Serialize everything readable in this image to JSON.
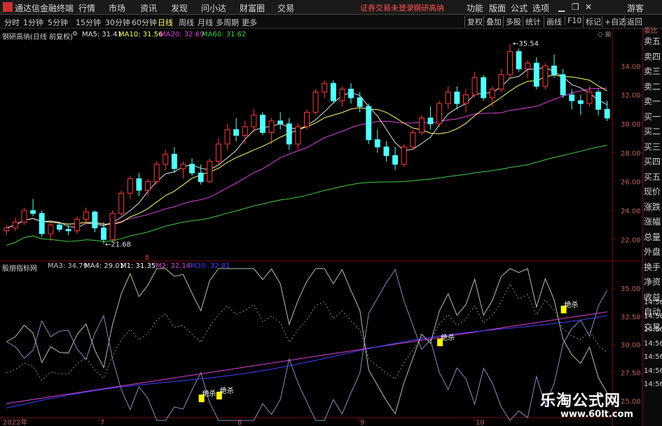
{
  "menubar": {
    "app_name": "通达信金融终端",
    "items": [
      "行情",
      "市场",
      "资讯",
      "发现",
      "问小达",
      "财富圈",
      "交易"
    ],
    "center_status": "证券交易未登录",
    "center_stock": "钢研高纳",
    "right_items": [
      "功能",
      "版面",
      "公式",
      "选项"
    ],
    "guest": "游客",
    "window_buttons": [
      "▁",
      "❐",
      "✕"
    ]
  },
  "toolbar": {
    "periods": [
      "分时",
      "1分钟",
      "5分钟",
      "15分钟",
      "30分钟",
      "60分钟",
      "日线",
      "周线",
      "月线",
      "多周期",
      "更多"
    ],
    "selected": "日线",
    "right_buttons": [
      "复权",
      "叠加",
      "多股",
      "统计",
      "画线",
      "F10",
      "标记",
      "+自选",
      "返回"
    ]
  },
  "main_chart": {
    "title": "钢研高纳(日线 前复权)",
    "ma_labels": [
      {
        "text": "MA5: 31.41",
        "color": "#e0e0e0"
      },
      {
        "text": "MA10: 31.56",
        "color": "#ffff66"
      },
      {
        "text": "MA20: 32.69",
        "color": "#e040e0"
      },
      {
        "text": "MA60: 31.62",
        "color": "#40d040"
      }
    ],
    "high_label": "35.54",
    "low_label": "21.68",
    "marker_8": "8"
  },
  "indicator": {
    "title": "股朋指标网",
    "labels": [
      {
        "text": "MA3: 34.79",
        "color": "#c0c0c0"
      },
      {
        "text": "MA4: 29.01",
        "color": "#e0e0e0"
      },
      {
        "text": "M1: 31.35",
        "color": "#ffffff"
      },
      {
        "text": "M2: 32.14",
        "color": "#e040e0"
      },
      {
        "text": "M30: 32.81",
        "color": "#4040ff"
      }
    ],
    "signal_label": "绝杀"
  },
  "right_panel": {
    "top_label": "委比",
    "items": [
      "卖五",
      "卖四",
      "卖三",
      "卖二",
      "卖一",
      "买一",
      "买二",
      "买三",
      "买四",
      "买五",
      "现价",
      "涨跌",
      "涨幅",
      "总量",
      "外盘",
      "换手",
      "净资",
      "收益",
      "自动",
      "交易"
    ],
    "time_items": [
      "14:56",
      "14:56",
      "14:56",
      "14:56",
      "14:56",
      "14:56",
      "14:56"
    ]
  },
  "watermark": {
    "text": "乐淘公式网",
    "url": "www.60lt.com"
  },
  "chart_data": [
    {
      "type": "candlestick",
      "ylim": [
        21,
        36
      ],
      "yticks": [
        22,
        24,
        26,
        28,
        30,
        32,
        34
      ],
      "x_labels": [
        "2022年",
        "7",
        "8",
        "9",
        "10"
      ],
      "ohlc": [
        [
          22.6,
          23.0,
          22.3,
          22.8
        ],
        [
          22.8,
          23.5,
          22.6,
          23.2
        ],
        [
          23.2,
          24.2,
          23.0,
          24.0
        ],
        [
          24.0,
          24.8,
          23.6,
          23.8
        ],
        [
          23.8,
          24.0,
          22.2,
          22.4
        ],
        [
          22.4,
          23.2,
          21.9,
          23.0
        ],
        [
          23.0,
          23.2,
          22.5,
          22.7
        ],
        [
          22.7,
          23.0,
          22.3,
          22.6
        ],
        [
          22.6,
          23.6,
          22.4,
          23.4
        ],
        [
          23.4,
          24.2,
          23.0,
          23.9
        ],
        [
          23.9,
          24.0,
          22.5,
          22.8
        ],
        [
          22.8,
          23.2,
          21.7,
          22.0
        ],
        [
          22.0,
          24.0,
          21.8,
          23.8
        ],
        [
          23.8,
          25.4,
          23.6,
          25.2
        ],
        [
          25.2,
          26.4,
          24.8,
          26.2
        ],
        [
          26.2,
          26.6,
          25.0,
          25.4
        ],
        [
          25.4,
          26.2,
          25.0,
          26.0
        ],
        [
          26.0,
          27.4,
          25.8,
          27.2
        ],
        [
          27.2,
          28.2,
          26.8,
          27.9
        ],
        [
          27.9,
          28.4,
          26.6,
          26.9
        ],
        [
          26.9,
          27.4,
          26.2,
          27.2
        ],
        [
          27.2,
          27.6,
          26.4,
          26.6
        ],
        [
          26.6,
          27.2,
          25.8,
          26.0
        ],
        [
          26.0,
          27.6,
          25.9,
          27.4
        ],
        [
          27.4,
          29.0,
          27.2,
          28.6
        ],
        [
          28.6,
          30.0,
          28.2,
          29.6
        ],
        [
          29.6,
          30.4,
          28.8,
          29.2
        ],
        [
          29.2,
          30.2,
          28.6,
          29.8
        ],
        [
          29.8,
          31.0,
          29.4,
          30.6
        ],
        [
          30.6,
          30.8,
          29.2,
          29.4
        ],
        [
          29.4,
          30.4,
          28.6,
          30.2
        ],
        [
          30.2,
          30.8,
          29.6,
          30.0
        ],
        [
          30.0,
          30.4,
          28.2,
          28.6
        ],
        [
          28.6,
          30.0,
          28.2,
          29.8
        ],
        [
          29.8,
          31.0,
          29.6,
          30.8
        ],
        [
          30.8,
          32.4,
          30.6,
          32.2
        ],
        [
          32.2,
          33.0,
          31.8,
          32.8
        ],
        [
          32.8,
          33.0,
          31.4,
          31.6
        ],
        [
          31.6,
          32.6,
          31.2,
          32.4
        ],
        [
          32.4,
          32.8,
          31.4,
          31.8
        ],
        [
          31.8,
          32.2,
          30.8,
          31.2
        ],
        [
          31.2,
          31.4,
          28.6,
          28.9
        ],
        [
          28.9,
          29.6,
          28.0,
          28.4
        ],
        [
          28.4,
          28.8,
          27.4,
          27.8
        ],
        [
          27.8,
          28.4,
          26.8,
          27.2
        ],
        [
          27.2,
          28.6,
          27.0,
          28.4
        ],
        [
          28.4,
          29.6,
          28.2,
          29.4
        ],
        [
          29.4,
          30.6,
          29.2,
          30.4
        ],
        [
          30.4,
          31.2,
          29.6,
          30.0
        ],
        [
          30.0,
          31.6,
          29.8,
          31.4
        ],
        [
          31.4,
          32.6,
          31.0,
          32.2
        ],
        [
          32.2,
          32.6,
          31.0,
          31.4
        ],
        [
          31.4,
          32.4,
          30.8,
          32.0
        ],
        [
          32.0,
          33.6,
          31.8,
          33.2
        ],
        [
          33.2,
          33.4,
          31.6,
          31.8
        ],
        [
          31.8,
          32.6,
          31.2,
          32.4
        ],
        [
          32.4,
          33.8,
          32.2,
          33.4
        ],
        [
          33.4,
          35.5,
          33.2,
          35.0
        ],
        [
          35.0,
          35.2,
          33.6,
          33.8
        ],
        [
          33.8,
          34.4,
          33.2,
          34.2
        ],
        [
          34.2,
          34.6,
          32.4,
          32.6
        ],
        [
          32.6,
          34.2,
          32.4,
          34.0
        ],
        [
          34.0,
          34.8,
          33.2,
          33.4
        ],
        [
          33.4,
          33.8,
          31.8,
          32.0
        ],
        [
          32.0,
          32.4,
          31.0,
          31.6
        ],
        [
          31.6,
          32.0,
          30.6,
          31.4
        ],
        [
          31.4,
          32.6,
          31.2,
          32.2
        ],
        [
          32.2,
          32.4,
          30.6,
          31.0
        ],
        [
          31.0,
          31.6,
          30.2,
          30.4
        ]
      ]
    },
    {
      "type": "line",
      "ylim": [
        23.5,
        37
      ],
      "yticks": [
        25.0,
        27.5,
        30.0,
        32.5,
        35.0
      ]
    }
  ]
}
